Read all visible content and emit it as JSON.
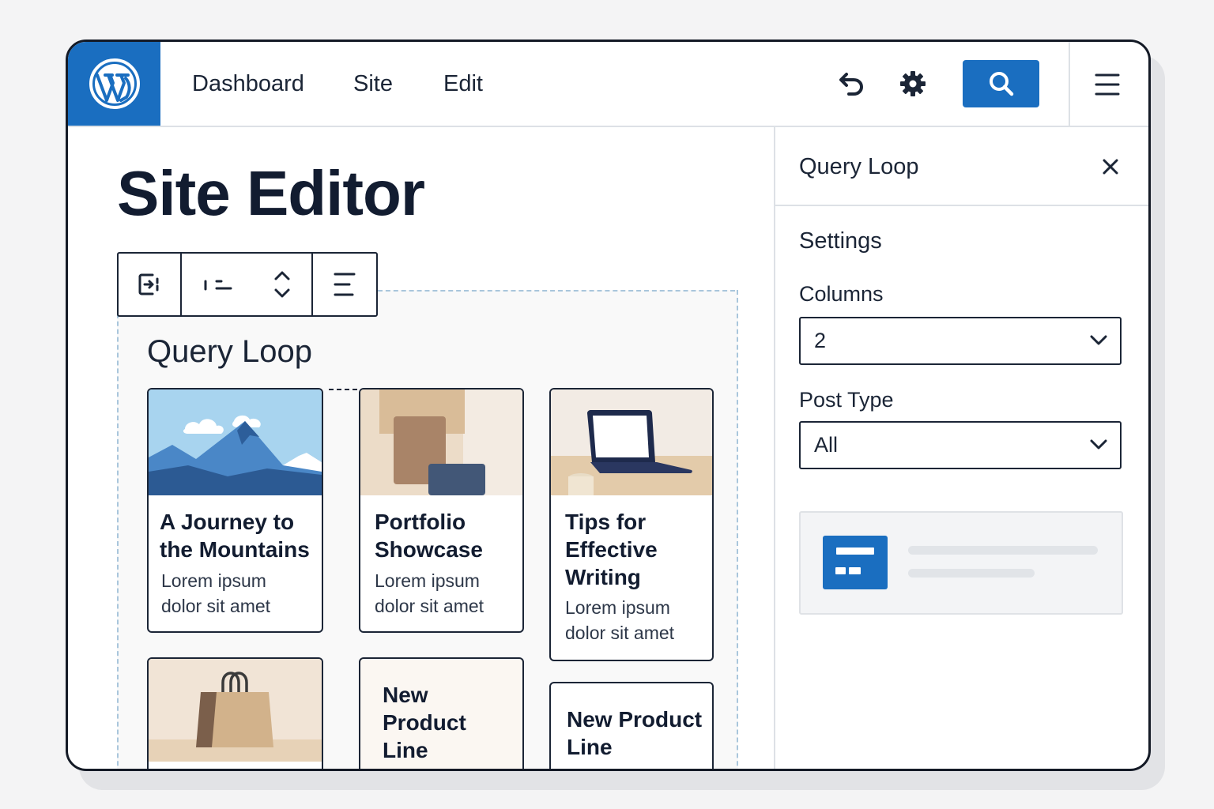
{
  "topbar": {
    "logo_alt": "WordPress",
    "nav": [
      "Dashboard",
      "Site",
      "Edit"
    ],
    "icons": [
      "undo-icon",
      "gear-icon",
      "search-icon",
      "hamburger-menu-icon"
    ],
    "accent_color": "#1a6ec0"
  },
  "main": {
    "page_title": "Site Editor",
    "toolbar": {
      "icons": [
        "block-transform-icon",
        "drag-handle-icon",
        "move-up-down-icon",
        "align-icon"
      ]
    },
    "query_loop": {
      "title": "Query Loop",
      "cards": [
        {
          "title": "A Journey to the Mountains",
          "excerpt": "Lorem ipsum dolor sit amet",
          "image": "mountain-image"
        },
        {
          "title": "Portfolio Showcase",
          "excerpt": "Lorem ipsum dolor sit amet",
          "image": "portfolio-image"
        },
        {
          "title": "Tips for Effective Writing",
          "excerpt": "Lorem ipsum dolor sit amet",
          "image": "laptop-image"
        },
        {
          "title": "",
          "excerpt": "",
          "image": "shopping-bag-image"
        },
        {
          "title": "New Product Line",
          "excerpt": ""
        },
        {
          "title": "New Product Line",
          "excerpt": ""
        }
      ]
    }
  },
  "sidebar": {
    "title": "Query Loop",
    "section": "Settings",
    "columns": {
      "label": "Columns",
      "value": "2"
    },
    "post_type": {
      "label": "Post Type",
      "value": "All"
    }
  }
}
